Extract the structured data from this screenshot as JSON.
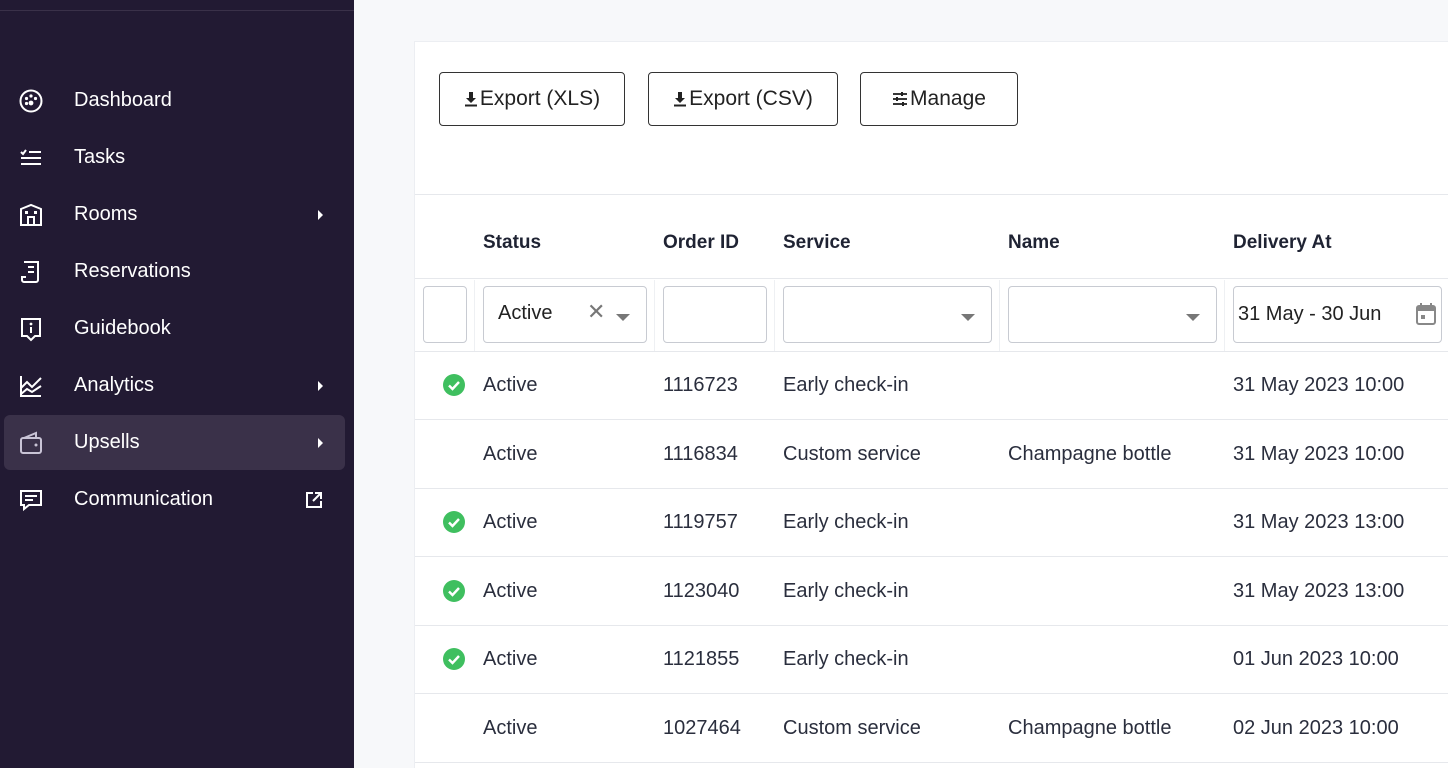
{
  "sidebar": {
    "items": [
      {
        "label": "Dashboard",
        "icon": "dashboard-gauge-icon"
      },
      {
        "label": "Tasks",
        "icon": "tasks-list-icon"
      },
      {
        "label": "Rooms",
        "icon": "rooms-building-icon"
      },
      {
        "label": "Reservations",
        "icon": "reservations-receipt-icon"
      },
      {
        "label": "Guidebook",
        "icon": "guidebook-info-icon"
      },
      {
        "label": "Analytics",
        "icon": "analytics-chart-icon"
      },
      {
        "label": "Upsells",
        "icon": "upsells-wallet-icon"
      },
      {
        "label": "Communication",
        "icon": "communication-chat-icon"
      }
    ],
    "active_item": "Upsells"
  },
  "toolbar": {
    "export_xls_label": "Export (XLS)",
    "export_csv_label": "Export (CSV)",
    "manage_label": "Manage"
  },
  "table": {
    "columns": [
      "Status",
      "Order ID",
      "Service",
      "Name",
      "Delivery At"
    ],
    "filters": {
      "status_value": "Active",
      "date_range_value": "31 May - 30 Jun"
    },
    "rows": [
      {
        "checked": true,
        "status": "Active",
        "order_id": "1116723",
        "service": "Early check-in",
        "name": "",
        "delivery_at": "31 May 2023 10:00"
      },
      {
        "checked": false,
        "status": "Active",
        "order_id": "1116834",
        "service": "Custom service",
        "name": "Champagne bottle",
        "delivery_at": "31 May 2023 10:00"
      },
      {
        "checked": true,
        "status": "Active",
        "order_id": "1119757",
        "service": "Early check-in",
        "name": "",
        "delivery_at": "31 May 2023 13:00"
      },
      {
        "checked": true,
        "status": "Active",
        "order_id": "1123040",
        "service": "Early check-in",
        "name": "",
        "delivery_at": "31 May 2023 13:00"
      },
      {
        "checked": true,
        "status": "Active",
        "order_id": "1121855",
        "service": "Early check-in",
        "name": "",
        "delivery_at": "01 Jun 2023 10:00"
      },
      {
        "checked": false,
        "status": "Active",
        "order_id": "1027464",
        "service": "Custom service",
        "name": "Champagne bottle",
        "delivery_at": "02 Jun 2023 10:00"
      }
    ]
  },
  "colors": {
    "sidebar_bg": "#221a33",
    "sidebar_active": "#3a3149",
    "check_green": "#3fbf5f"
  }
}
